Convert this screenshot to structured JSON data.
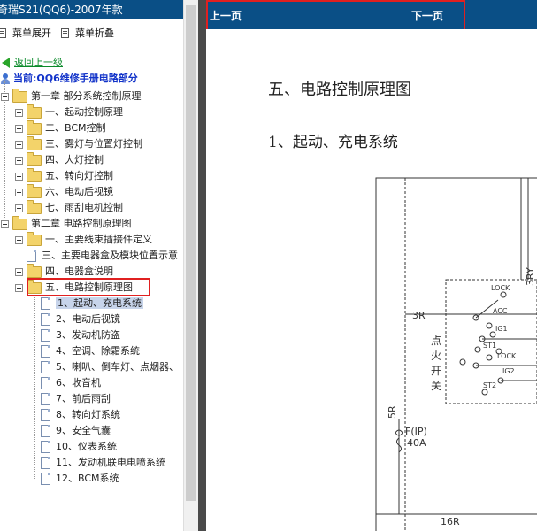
{
  "title": "奇瑞S21(QQ6)-2007年款",
  "menu": {
    "expand": "菜单展开",
    "collapse": "菜单折叠"
  },
  "tree": {
    "back": "返回上一级",
    "current": "当前:QQ6维修手册电路部分",
    "ch1": {
      "label": "第一章 部分系统控制原理",
      "items": [
        "一、起动控制原理",
        "二、BCM控制",
        "三、雾灯与位置灯控制",
        "四、大灯控制",
        "五、转向灯控制",
        "六、电动后视镜",
        "七、雨刮电机控制"
      ]
    },
    "ch2": {
      "label": "第二章 电路控制原理图",
      "items": [
        "一、主要线束插接件定义",
        "三、主要电器盒及模块位置示意",
        "四、电器盒说明",
        "五、电路控制原理图"
      ]
    },
    "sub": [
      "1、起动、充电系统",
      "2、电动后视镜",
      "3、发动机防盗",
      "4、空调、除霜系统",
      "5、喇叭、倒车灯、点烟器、",
      "6、收音机",
      "7、前后雨刮",
      "8、转向灯系统",
      "9、安全气囊",
      "10、仪表系统",
      "11、发动机联电电喷系统",
      "12、BCM系统"
    ]
  },
  "nav": {
    "prev": "上一页",
    "next": "下一页"
  },
  "doc": {
    "heading": "五、电路控制原理图",
    "subheading": "1、起动、充电系统",
    "diagram": {
      "wire_3r": "3R",
      "wire_3ry": "3RY",
      "switch_label": [
        "点",
        "火",
        "开",
        "关"
      ],
      "pins": [
        "LOCK",
        "ACC",
        "IG1",
        "ST1",
        "LOCK",
        "IG2",
        "ST2"
      ],
      "wire_5r": "5R",
      "fuse": "F(IP)",
      "fuse_rating": "40A",
      "wire_16r": "16R"
    }
  },
  "colors": {
    "nav_bg": "#0a4f86",
    "highlight": "#e02020",
    "selected": "#c7d4ea"
  }
}
